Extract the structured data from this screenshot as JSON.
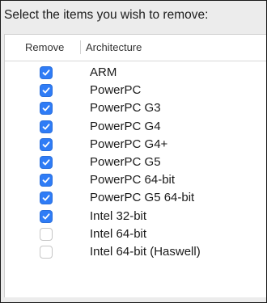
{
  "prompt": "Select the items you wish to remove:",
  "table": {
    "columns": {
      "remove": "Remove",
      "architecture": "Architecture"
    },
    "rows": [
      {
        "label": "ARM",
        "checked": true
      },
      {
        "label": "PowerPC",
        "checked": true
      },
      {
        "label": "PowerPC G3",
        "checked": true
      },
      {
        "label": "PowerPC G4",
        "checked": true
      },
      {
        "label": "PowerPC G4+",
        "checked": true
      },
      {
        "label": "PowerPC G5",
        "checked": true
      },
      {
        "label": "PowerPC 64-bit",
        "checked": true
      },
      {
        "label": "PowerPC G5 64-bit",
        "checked": true
      },
      {
        "label": "Intel 32-bit",
        "checked": true
      },
      {
        "label": "Intel 64-bit",
        "checked": false
      },
      {
        "label": "Intel 64-bit (Haswell)",
        "checked": false
      }
    ]
  },
  "colors": {
    "checkbox_checked": "#2f7cf6",
    "checkbox_unchecked": "#ffffff"
  },
  "icons": {
    "checked": "checkmark-icon"
  }
}
